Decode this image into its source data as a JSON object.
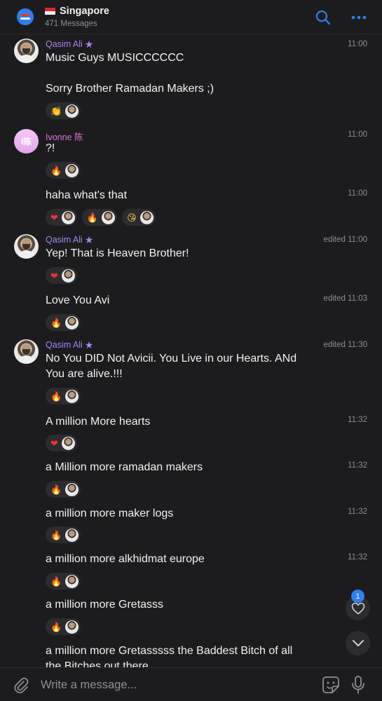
{
  "header": {
    "title": "Singapore",
    "subtitle": "471 Messages",
    "icons": {
      "app": "chat-bubble-icon",
      "search": "search-icon",
      "more": "more-icon"
    }
  },
  "colors": {
    "accent": "#2f80ed",
    "qasim": "#a884f3",
    "ivonne": "#e070d6",
    "background": "#1c1c1e",
    "reaction_bg": "#2c2c2e"
  },
  "messages": [
    {
      "sender": "Qasim Ali",
      "time": "11:00",
      "lines": [
        "Music Guys MUSICCCCCC",
        "Sorry Brother Ramadan Makers ;)"
      ],
      "reactions": [
        "clap"
      ]
    },
    {
      "sender": "Ivonne 陈",
      "avatar_initials": "I陈",
      "time": "11:00",
      "text": "?!",
      "reactions": [
        "fire"
      ]
    },
    {
      "time": "11:00",
      "text": "haha what's that",
      "reactions": [
        "heart",
        "fire",
        "kiss"
      ]
    },
    {
      "sender": "Qasim Ali",
      "time": "edited 11:00",
      "text": "Yep! That is Heaven Brother!",
      "reactions": [
        "heart"
      ]
    },
    {
      "time": "edited 11:03",
      "text": "Love You Avi",
      "reactions": [
        "fire"
      ]
    },
    {
      "sender": "Qasim Ali",
      "time": "edited 11:30",
      "lines": [
        "No You DID Not Avicii. You Live in our Hearts. ANd",
        "You are alive.!!!"
      ],
      "reactions": [
        "fire"
      ]
    },
    {
      "time": "11:32",
      "text": "A million More hearts",
      "reactions": [
        "heart"
      ]
    },
    {
      "time": "11:32",
      "text": "a Million more ramadan makers",
      "reactions": [
        "fire"
      ]
    },
    {
      "time": "11:32",
      "text": "a million more maker logs",
      "reactions": [
        "fire"
      ]
    },
    {
      "time": "11:32",
      "text": "a million more alkhidmat europe",
      "reactions": [
        "fire"
      ]
    },
    {
      "text": "a million more Gretasss",
      "reactions": [
        "fire"
      ]
    },
    {
      "lines": [
        "a million more Gretasssss the Baddest Bitch of all",
        "the Bitches out there"
      ]
    }
  ],
  "floating": {
    "badge_count": "1",
    "heart_icon": "heart-icon",
    "scroll_icon": "chevron-down-icon"
  },
  "composer": {
    "placeholder": "Write a message...",
    "icons": {
      "attach": "paperclip-icon",
      "sticker": "sticker-icon",
      "mic": "microphone-icon"
    }
  }
}
